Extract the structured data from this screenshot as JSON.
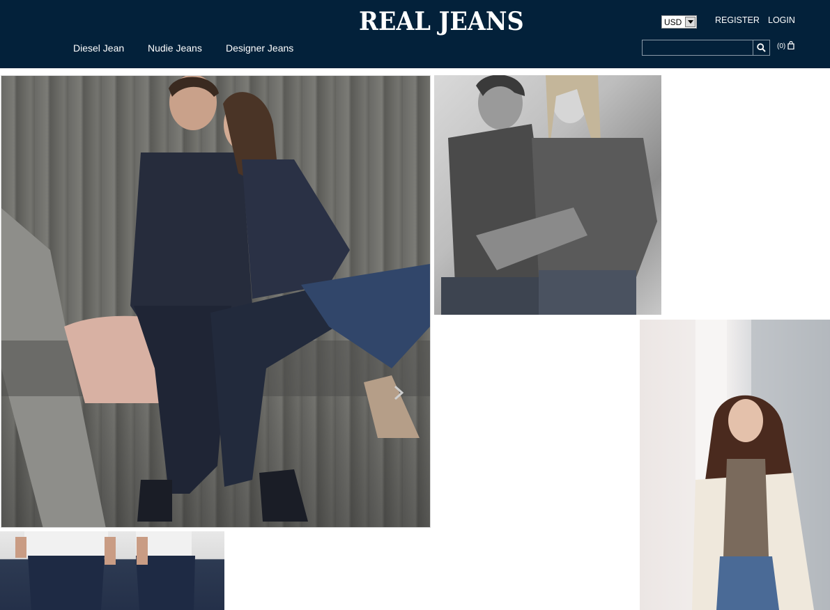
{
  "header": {
    "logo": "REAL JEANS",
    "nav": [
      "Diesel Jean",
      "Nudie Jeans",
      "Designer Jeans"
    ],
    "currency": "USD",
    "register": "REGISTER",
    "login": "LOGIN",
    "search_value": "",
    "cart_count": "(0)",
    "icons": {
      "search": "search-icon",
      "cart": "shopping-bag-icon",
      "dropdown": "chevron-down-icon"
    }
  },
  "gallery": {
    "next_icon": "chevron-right-icon"
  },
  "colors": {
    "header_bg": "#03213a",
    "text": "#ffffff"
  }
}
